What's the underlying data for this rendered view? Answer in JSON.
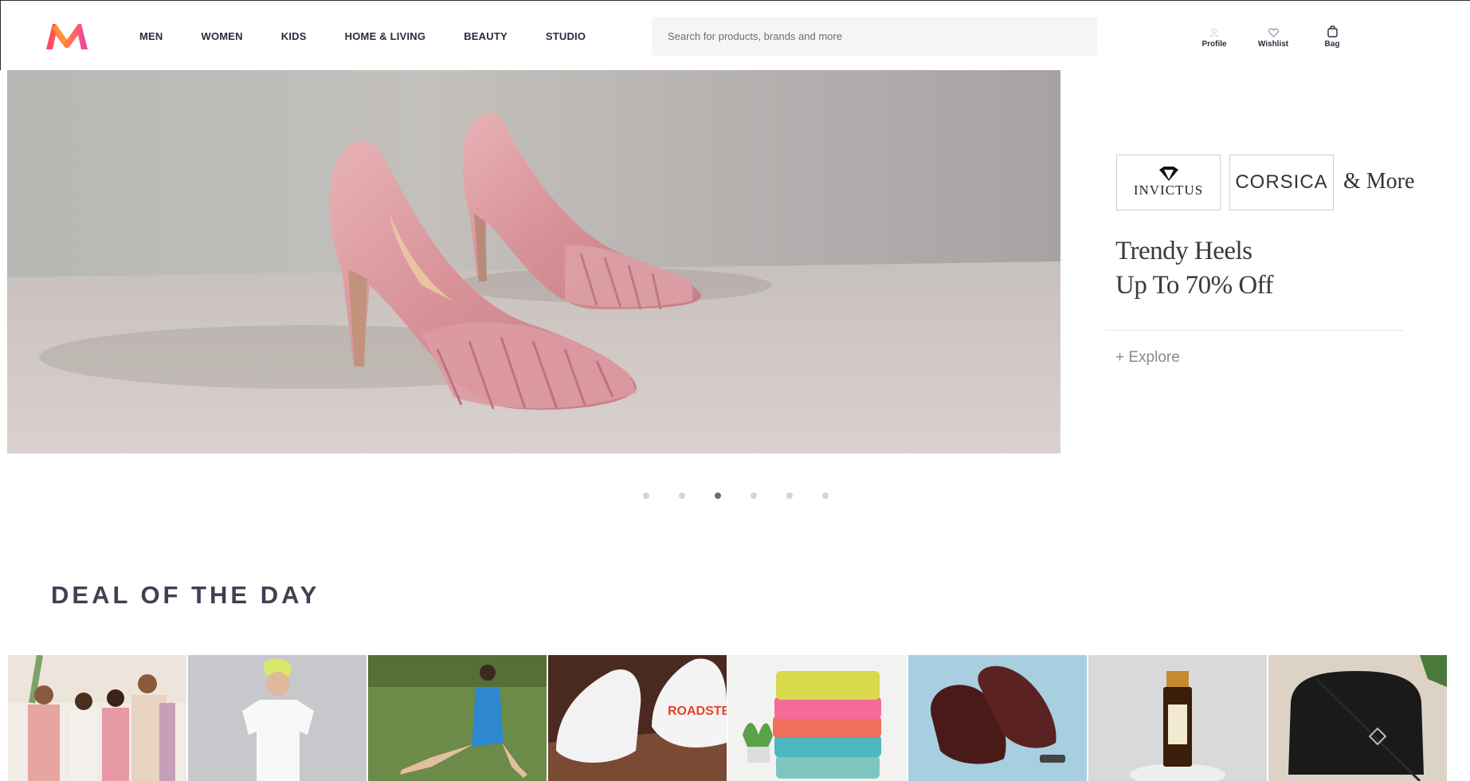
{
  "brand": {
    "logo_icon": "myntra-logo-icon"
  },
  "nav": {
    "items": [
      {
        "label": "MEN"
      },
      {
        "label": "WOMEN"
      },
      {
        "label": "KIDS"
      },
      {
        "label": "HOME & LIVING"
      },
      {
        "label": "BEAUTY"
      },
      {
        "label": "STUDIO"
      }
    ]
  },
  "search": {
    "placeholder": "Search for products, brands and more",
    "value": ""
  },
  "actions": {
    "profile": {
      "label": "Profile",
      "icon": "user-icon"
    },
    "wishlist": {
      "label": "Wishlist",
      "icon": "heart-icon"
    },
    "bag": {
      "label": "Bag",
      "icon": "bag-icon"
    }
  },
  "promo": {
    "brand1": "INVICTUS",
    "brand2": "CORSICA",
    "and_more": "& More",
    "title_line1": "Trendy Heels",
    "title_line2": "Up To 70% Off",
    "explore": "+ Explore"
  },
  "carousel": {
    "total": 6,
    "active_index": 3
  },
  "deals": {
    "title": "DEAL OF THE DAY"
  },
  "colors": {
    "accent": "#ff3f6c",
    "logo_orange": "#ff8a1f",
    "logo_pink": "#e91e8c",
    "text": "#282c3f",
    "search_bg": "#f5f5f6"
  }
}
